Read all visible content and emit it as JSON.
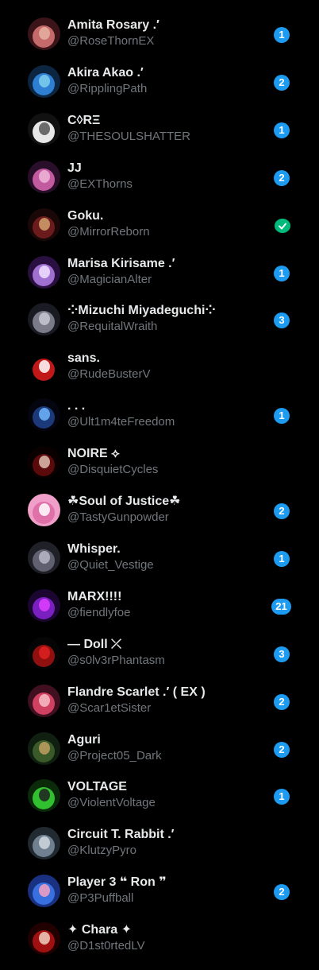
{
  "accounts": [
    {
      "name": "Amita Rosary .′",
      "handle": "@RoseThornEX",
      "badge": "1",
      "badge_type": "count",
      "avatar_colors": [
        "#3a1418",
        "#c46a6a",
        "#e7b0a0"
      ]
    },
    {
      "name": "Akira Akao .′",
      "handle": "@RipplingPath",
      "badge": "2",
      "badge_type": "count",
      "avatar_colors": [
        "#0c2540",
        "#2e7ed1",
        "#7fd0f0"
      ]
    },
    {
      "name": "C◊RΞ",
      "handle": "@THESOULSHATTER",
      "badge": "1",
      "badge_type": "count",
      "avatar_colors": [
        "#111111",
        "#e8e8e8",
        "#555555"
      ]
    },
    {
      "name": "JJ",
      "handle": "@EXThorns",
      "badge": "2",
      "badge_type": "count",
      "avatar_colors": [
        "#2a0f2a",
        "#c25aa0",
        "#f0b6d8"
      ]
    },
    {
      "name": "Goku.",
      "handle": "@MirrorReborn",
      "badge": "✓",
      "badge_type": "verified",
      "avatar_colors": [
        "#1a0808",
        "#6b1b1b",
        "#d2a070"
      ]
    },
    {
      "name": "Marisa Kirisame .′",
      "handle": "@MagicianAlter",
      "badge": "1",
      "badge_type": "count",
      "avatar_colors": [
        "#2a1040",
        "#a070d0",
        "#f0e0ff"
      ]
    },
    {
      "name": "⁘Mizuchi Miyadeguchi⁘",
      "handle": "@RequitalWraith",
      "badge": "3",
      "badge_type": "count",
      "avatar_colors": [
        "#1a1a22",
        "#7a7a88",
        "#c8c8d4"
      ]
    },
    {
      "name": "sans.",
      "handle": "@RudeBusterV",
      "badge": "",
      "badge_type": "none",
      "avatar_colors": [
        "#000000",
        "#c01818",
        "#ffffff"
      ]
    },
    {
      "name": ". . .",
      "handle": "@Ult1m4teFreedom",
      "badge": "1",
      "badge_type": "count",
      "avatar_colors": [
        "#050510",
        "#1c3a7a",
        "#6fb6ff"
      ]
    },
    {
      "name": "NOIRE ⟡",
      "handle": "@DisquietCycles",
      "badge": "",
      "badge_type": "none",
      "avatar_colors": [
        "#0a0000",
        "#5a0a0a",
        "#e0c0b0"
      ]
    },
    {
      "name": "☘Soul of Justice☘",
      "handle": "@TastyGunpowder",
      "badge": "2",
      "badge_type": "count",
      "avatar_colors": [
        "#f0a0c8",
        "#e070a8",
        "#ffffff"
      ]
    },
    {
      "name": "Whisper.",
      "handle": "@Quiet_Vestige",
      "badge": "1",
      "badge_type": "count",
      "avatar_colors": [
        "#202028",
        "#606070",
        "#b8b8c8"
      ]
    },
    {
      "name": "MARX!!!!",
      "handle": "@fiendlyfoe",
      "badge": "21",
      "badge_type": "count",
      "avatar_colors": [
        "#1a0630",
        "#7a20c0",
        "#e040ff"
      ]
    },
    {
      "name": "— Doll ⤫",
      "handle": "@s0lv3rPhantasm",
      "badge": "3",
      "badge_type": "count",
      "avatar_colors": [
        "#050505",
        "#901010",
        "#e02020"
      ]
    },
    {
      "name": "Flandre Scarlet .′ ( EX )",
      "handle": "@Scar1etSister",
      "badge": "2",
      "badge_type": "count",
      "avatar_colors": [
        "#401020",
        "#d04060",
        "#f8c0c8"
      ]
    },
    {
      "name": "Aguri",
      "handle": "@Project05_Dark",
      "badge": "2",
      "badge_type": "count",
      "avatar_colors": [
        "#102010",
        "#3a5a2a",
        "#c0a060"
      ]
    },
    {
      "name": "VOLTAGE",
      "handle": "@ViolentVoltage",
      "badge": "1",
      "badge_type": "count",
      "avatar_colors": [
        "#0a2a0a",
        "#30c030",
        "#202020"
      ]
    },
    {
      "name": "Circuit T. Rabbit .′",
      "handle": "@KlutzyPyro",
      "badge": "",
      "badge_type": "none",
      "avatar_colors": [
        "#202a30",
        "#708090",
        "#d0d8e0"
      ]
    },
    {
      "name": "Player 3 ❝ Ron ❞",
      "handle": "@P3Puffball",
      "badge": "2",
      "badge_type": "count",
      "avatar_colors": [
        "#1a3080",
        "#3870e0",
        "#f8a0c0"
      ]
    },
    {
      "name": "✦ Chara ✦",
      "handle": "@D1st0rtedLV",
      "badge": "",
      "badge_type": "none",
      "avatar_colors": [
        "#200000",
        "#a01010",
        "#f0d0c0"
      ]
    }
  ]
}
